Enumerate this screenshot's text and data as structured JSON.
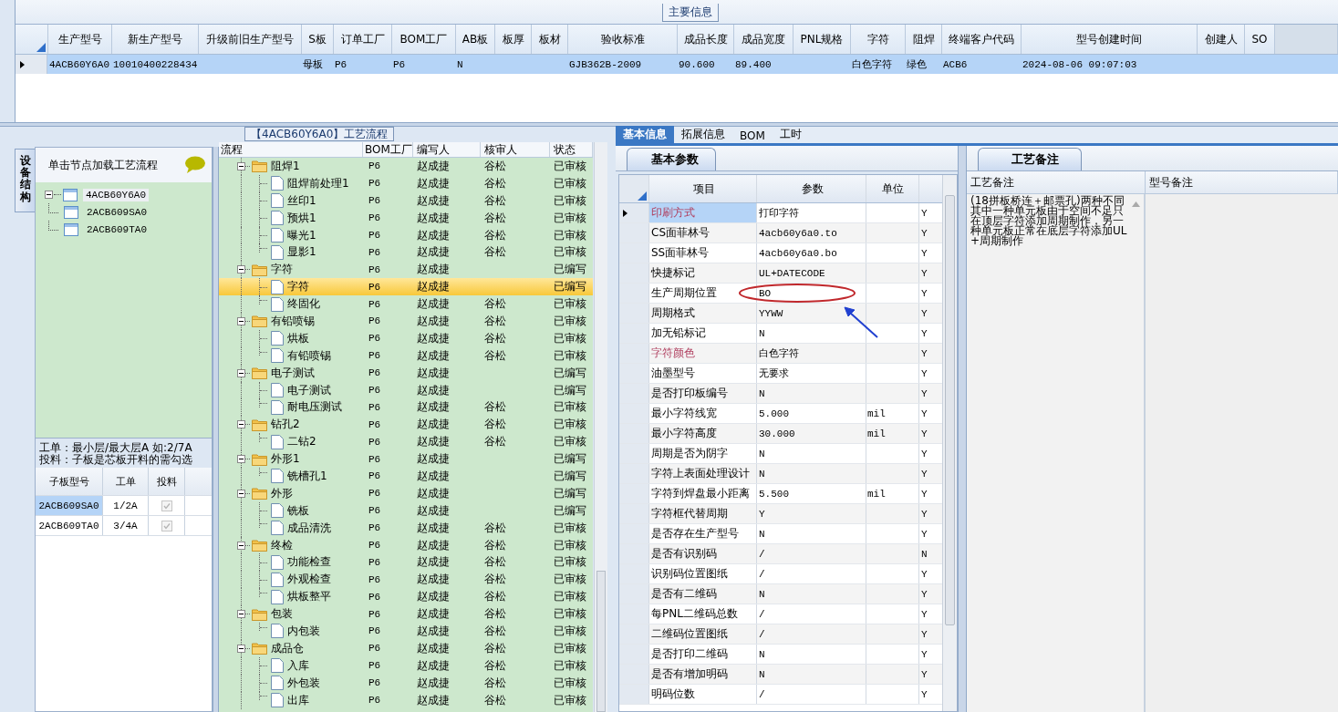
{
  "main_info": {
    "group_title": "主要信息",
    "columns": [
      "生产型号",
      "新生产型号",
      "升级前旧生产型号",
      "S板",
      "订单工厂",
      "BOM工厂",
      "AB板",
      "板厚",
      "板材",
      "验收标准",
      "成品长度",
      "成品宽度",
      "PNL规格",
      "字符",
      "阻焊",
      "终端客户代码",
      "型号创建时间",
      "创建人",
      "SO"
    ],
    "rows": [
      {
        "selected": true,
        "cells": [
          "4ACB60Y6A0",
          "10010400228434",
          null,
          "母板",
          "P6",
          "P6",
          "N",
          null,
          null,
          "GJB362B-2009",
          "90.600",
          "89.400",
          null,
          "白色字符",
          "绿色",
          "ACB6",
          "2024-08-06 09:07:03",
          null,
          null
        ]
      }
    ]
  },
  "structure": {
    "side_tab": "设备结构",
    "hint": "单击节点加载工艺流程",
    "tree": [
      {
        "label": "4ACB60Y6A0",
        "selected": true,
        "expanded": true,
        "children": [
          {
            "label": "2ACB609SA0",
            "selected": false
          },
          {
            "label": "2ACB609TA0",
            "selected": false
          }
        ]
      }
    ],
    "notes": [
      "工单：最小层/最大层A 如:2/7A",
      "投料：子板是芯板开料的需勾选"
    ],
    "sub_boards": {
      "columns": [
        "子板型号",
        "工单",
        "投料"
      ],
      "rows": [
        {
          "board": "2ACB609SA0",
          "order": "1/2A",
          "feed": true,
          "selected": true,
          "disabled": true
        },
        {
          "board": "2ACB609TA0",
          "order": "3/4A",
          "feed": true,
          "selected": false,
          "disabled": true
        }
      ]
    }
  },
  "process": {
    "title": "【4ACB60Y6A0】工艺流程",
    "columns": [
      "流程",
      "BOM工厂",
      "编写人",
      "核审人",
      "状态"
    ],
    "rows": [
      {
        "name": "阻焊1",
        "bom": "P6",
        "author": "赵成捷",
        "reviewer": "谷松",
        "status": "已审核",
        "selected": false,
        "expanded": true,
        "children": [
          {
            "name": "阻焊前处理1",
            "bom": "P6",
            "author": "赵成捷",
            "reviewer": "谷松",
            "status": "已审核",
            "selected": false
          },
          {
            "name": "丝印1",
            "bom": "P6",
            "author": "赵成捷",
            "reviewer": "谷松",
            "status": "已审核",
            "selected": false
          },
          {
            "name": "预烘1",
            "bom": "P6",
            "author": "赵成捷",
            "reviewer": "谷松",
            "status": "已审核",
            "selected": false
          },
          {
            "name": "曝光1",
            "bom": "P6",
            "author": "赵成捷",
            "reviewer": "谷松",
            "status": "已审核",
            "selected": false
          },
          {
            "name": "显影1",
            "bom": "P6",
            "author": "赵成捷",
            "reviewer": "谷松",
            "status": "已审核",
            "selected": false
          }
        ]
      },
      {
        "name": "字符",
        "bom": "P6",
        "author": "赵成捷",
        "status": "已编写",
        "selected": false,
        "expanded": true,
        "children": [
          {
            "name": "字符",
            "bom": "P6",
            "author": "赵成捷",
            "status": "已编写",
            "selected": true
          },
          {
            "name": "终固化",
            "bom": "P6",
            "author": "赵成捷",
            "reviewer": "谷松",
            "status": "已审核",
            "selected": false
          }
        ]
      },
      {
        "name": "有铅喷锡",
        "bom": "P6",
        "author": "赵成捷",
        "reviewer": "谷松",
        "status": "已审核",
        "selected": false,
        "expanded": true,
        "children": [
          {
            "name": "烘板",
            "bom": "P6",
            "author": "赵成捷",
            "reviewer": "谷松",
            "status": "已审核",
            "selected": false
          },
          {
            "name": "有铅喷锡",
            "bom": "P6",
            "author": "赵成捷",
            "reviewer": "谷松",
            "status": "已审核",
            "selected": false
          }
        ]
      },
      {
        "name": "电子测试",
        "bom": "P6",
        "author": "赵成捷",
        "status": "已编写",
        "selected": false,
        "expanded": true,
        "children": [
          {
            "name": "电子测试",
            "bom": "P6",
            "author": "赵成捷",
            "status": "已编写",
            "selected": false
          },
          {
            "name": "耐电压测试",
            "bom": "P6",
            "author": "赵成捷",
            "reviewer": "谷松",
            "status": "已审核",
            "selected": false
          }
        ]
      },
      {
        "name": "钻孔2",
        "bom": "P6",
        "author": "赵成捷",
        "reviewer": "谷松",
        "status": "已审核",
        "selected": false,
        "expanded": true,
        "children": [
          {
            "name": "二钻2",
            "bom": "P6",
            "author": "赵成捷",
            "reviewer": "谷松",
            "status": "已审核",
            "selected": false
          }
        ]
      },
      {
        "name": "外形1",
        "bom": "P6",
        "author": "赵成捷",
        "status": "已编写",
        "selected": false,
        "expanded": true,
        "children": [
          {
            "name": "铣槽孔1",
            "bom": "P6",
            "author": "赵成捷",
            "status": "已编写",
            "selected": false
          }
        ]
      },
      {
        "name": "外形",
        "bom": "P6",
        "author": "赵成捷",
        "status": "已编写",
        "selected": false,
        "expanded": true,
        "children": [
          {
            "name": "铣板",
            "bom": "P6",
            "author": "赵成捷",
            "status": "已编写",
            "selected": false
          },
          {
            "name": "成品清洗",
            "bom": "P6",
            "author": "赵成捷",
            "reviewer": "谷松",
            "status": "已审核",
            "selected": false
          }
        ]
      },
      {
        "name": "终检",
        "bom": "P6",
        "author": "赵成捷",
        "reviewer": "谷松",
        "status": "已审核",
        "selected": false,
        "expanded": true,
        "children": [
          {
            "name": "功能检查",
            "bom": "P6",
            "author": "赵成捷",
            "reviewer": "谷松",
            "status": "已审核",
            "selected": false
          },
          {
            "name": "外观检查",
            "bom": "P6",
            "author": "赵成捷",
            "reviewer": "谷松",
            "status": "已审核",
            "selected": false
          },
          {
            "name": "烘板整平",
            "bom": "P6",
            "author": "赵成捷",
            "reviewer": "谷松",
            "status": "已审核",
            "selected": false
          }
        ]
      },
      {
        "name": "包装",
        "bom": "P6",
        "author": "赵成捷",
        "reviewer": "谷松",
        "status": "已审核",
        "selected": false,
        "expanded": true,
        "children": [
          {
            "name": "内包装",
            "bom": "P6",
            "author": "赵成捷",
            "reviewer": "谷松",
            "status": "已审核",
            "selected": false
          }
        ]
      },
      {
        "name": "成品仓",
        "bom": "P6",
        "author": "赵成捷",
        "reviewer": "谷松",
        "status": "已审核",
        "selected": false,
        "expanded": true,
        "children": [
          {
            "name": "入库",
            "bom": "P6",
            "author": "赵成捷",
            "reviewer": "谷松",
            "status": "已审核",
            "selected": false
          },
          {
            "name": "外包装",
            "bom": "P6",
            "author": "赵成捷",
            "reviewer": "谷松",
            "status": "已审核",
            "selected": false
          },
          {
            "name": "出库",
            "bom": "P6",
            "author": "赵成捷",
            "reviewer": "谷松",
            "status": "已审核",
            "selected": false
          }
        ]
      }
    ]
  },
  "detail_tabs": [
    {
      "label": "基本信息",
      "selected": true
    },
    {
      "label": "拓展信息",
      "selected": false
    },
    {
      "label": "BOM",
      "selected": false
    },
    {
      "label": "工时",
      "selected": false
    }
  ],
  "basic_params": {
    "tab": "基本参数",
    "columns": [
      "项目",
      "参数",
      "单位"
    ],
    "rows": [
      {
        "item": "印刷方式",
        "value": "打印字符",
        "flag": "Y",
        "selected": true,
        "highlighted": true,
        "circled": false
      },
      {
        "item": "CS面菲林号",
        "value": "4acb60y6a0.to",
        "flag": "Y",
        "selected": false,
        "highlighted": false,
        "circled": false
      },
      {
        "item": "SS面菲林号",
        "value": "4acb60y6a0.bo",
        "flag": "Y",
        "selected": false,
        "highlighted": false,
        "circled": false
      },
      {
        "item": "快捷标记",
        "value": "UL+DATECODE",
        "flag": "Y",
        "selected": false,
        "highlighted": false,
        "circled": false
      },
      {
        "item": "生产周期位置",
        "value": "BO",
        "flag": "Y",
        "selected": false,
        "highlighted": false,
        "circled": true
      },
      {
        "item": "周期格式",
        "value": "YYWW",
        "flag": "Y",
        "selected": false,
        "highlighted": false,
        "circled": false
      },
      {
        "item": "加无铅标记",
        "value": "N",
        "flag": "Y",
        "selected": false,
        "highlighted": false,
        "circled": false
      },
      {
        "item": "字符颜色",
        "value": "白色字符",
        "flag": "Y",
        "selected": false,
        "highlighted": true,
        "circled": false
      },
      {
        "item": "油墨型号",
        "value": "无要求",
        "flag": "Y",
        "selected": false,
        "highlighted": false,
        "circled": false
      },
      {
        "item": "是否打印板编号",
        "value": "N",
        "flag": "Y",
        "selected": false,
        "highlighted": false,
        "circled": false
      },
      {
        "item": "最小字符线宽",
        "value": "5.000",
        "unit": "mil",
        "flag": "Y",
        "selected": false,
        "highlighted": false,
        "circled": false
      },
      {
        "item": "最小字符高度",
        "value": "30.000",
        "unit": "mil",
        "flag": "Y",
        "selected": false,
        "highlighted": false,
        "circled": false
      },
      {
        "item": "周期是否为阴字",
        "value": "N",
        "flag": "Y",
        "selected": false,
        "highlighted": false,
        "circled": false
      },
      {
        "item": "字符上表面处理设计",
        "value": "N",
        "flag": "Y",
        "selected": false,
        "highlighted": false,
        "circled": false
      },
      {
        "item": "字符到焊盘最小距离",
        "value": "5.500",
        "unit": "mil",
        "flag": "Y",
        "selected": false,
        "highlighted": false,
        "circled": false
      },
      {
        "item": "字符框代替周期",
        "value": "Y",
        "flag": "Y",
        "selected": false,
        "highlighted": false,
        "circled": false
      },
      {
        "item": "是否存在生产型号",
        "value": "N",
        "flag": "Y",
        "selected": false,
        "highlighted": false,
        "circled": false
      },
      {
        "item": "是否有识别码",
        "value": "/",
        "flag": "N",
        "selected": false,
        "highlighted": false,
        "circled": false
      },
      {
        "item": "识别码位置图纸",
        "value": "/",
        "flag": "Y",
        "selected": false,
        "highlighted": false,
        "circled": false
      },
      {
        "item": "是否有二维码",
        "value": "N",
        "flag": "Y",
        "selected": false,
        "highlighted": false,
        "circled": false
      },
      {
        "item": "每PNL二维码总数",
        "value": "/",
        "flag": "Y",
        "selected": false,
        "highlighted": false,
        "circled": false
      },
      {
        "item": "二维码位置图纸",
        "value": "/",
        "flag": "Y",
        "selected": false,
        "highlighted": false,
        "circled": false
      },
      {
        "item": "是否打印二维码",
        "value": "N",
        "flag": "Y",
        "selected": false,
        "highlighted": false,
        "circled": false
      },
      {
        "item": "是否有增加明码",
        "value": "N",
        "flag": "Y",
        "selected": false,
        "highlighted": false,
        "circled": false
      },
      {
        "item": "明码位数",
        "value": "/",
        "flag": "Y",
        "selected": false,
        "highlighted": false,
        "circled": false
      }
    ]
  },
  "process_notes": {
    "tab": "工艺备注",
    "columns": [
      "工艺备注",
      "型号备注"
    ],
    "process_remark": "(18拼板桥连＋邮票孔)两种不同其中一种单元板由于空间不足只在顶层字符添加周期制作，另一种单元板正常在底层字符添加UL+周期制作"
  }
}
